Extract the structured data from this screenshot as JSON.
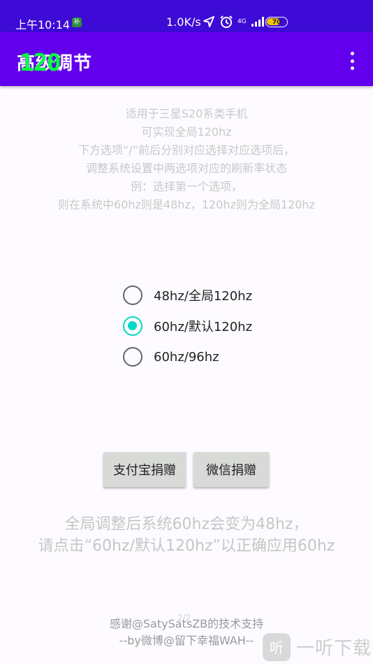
{
  "status_bar": {
    "time": "上午10:14",
    "app_badge": "补",
    "speed": "1.0K/s",
    "network": "4G",
    "battery": "70",
    "battery_level": 0.7
  },
  "app_bar": {
    "title": "高级调节",
    "badge": "120",
    "menu_icon": "more-vert-icon"
  },
  "description": [
    "适用于三星S20系类手机",
    "可实现全局120hz",
    "下方选项“/”前后分别对应选择对应选项后，",
    "调整系统设置中两选项对应的刷新率状态",
    "例：选择第一个选项，",
    "则在系统中60hz则是48hz，120hz则为全局120hz"
  ],
  "options": [
    {
      "label": "48hz/全局120hz",
      "checked": false
    },
    {
      "label": "60hz/默认120hz",
      "checked": true
    },
    {
      "label": "60hz/96hz",
      "checked": false
    }
  ],
  "buttons": {
    "alipay": "支付宝捐赠",
    "wechat": "微信捐赠"
  },
  "notice": [
    "全局调整后系统60hz会变为48hz，",
    "请点击“60hz/默认120hz”以正确应用60hz"
  ],
  "credits": [
    "感谢@SatySatsZB的技术支持",
    "--by微博@留下幸福WAH--"
  ],
  "page_indicator": "2/2",
  "watermark": {
    "logo": "听",
    "text": "一听下载"
  },
  "colors": {
    "status_bar": "#3d0ad6",
    "app_bar": "#6200ee",
    "accent": "#03dac5"
  }
}
